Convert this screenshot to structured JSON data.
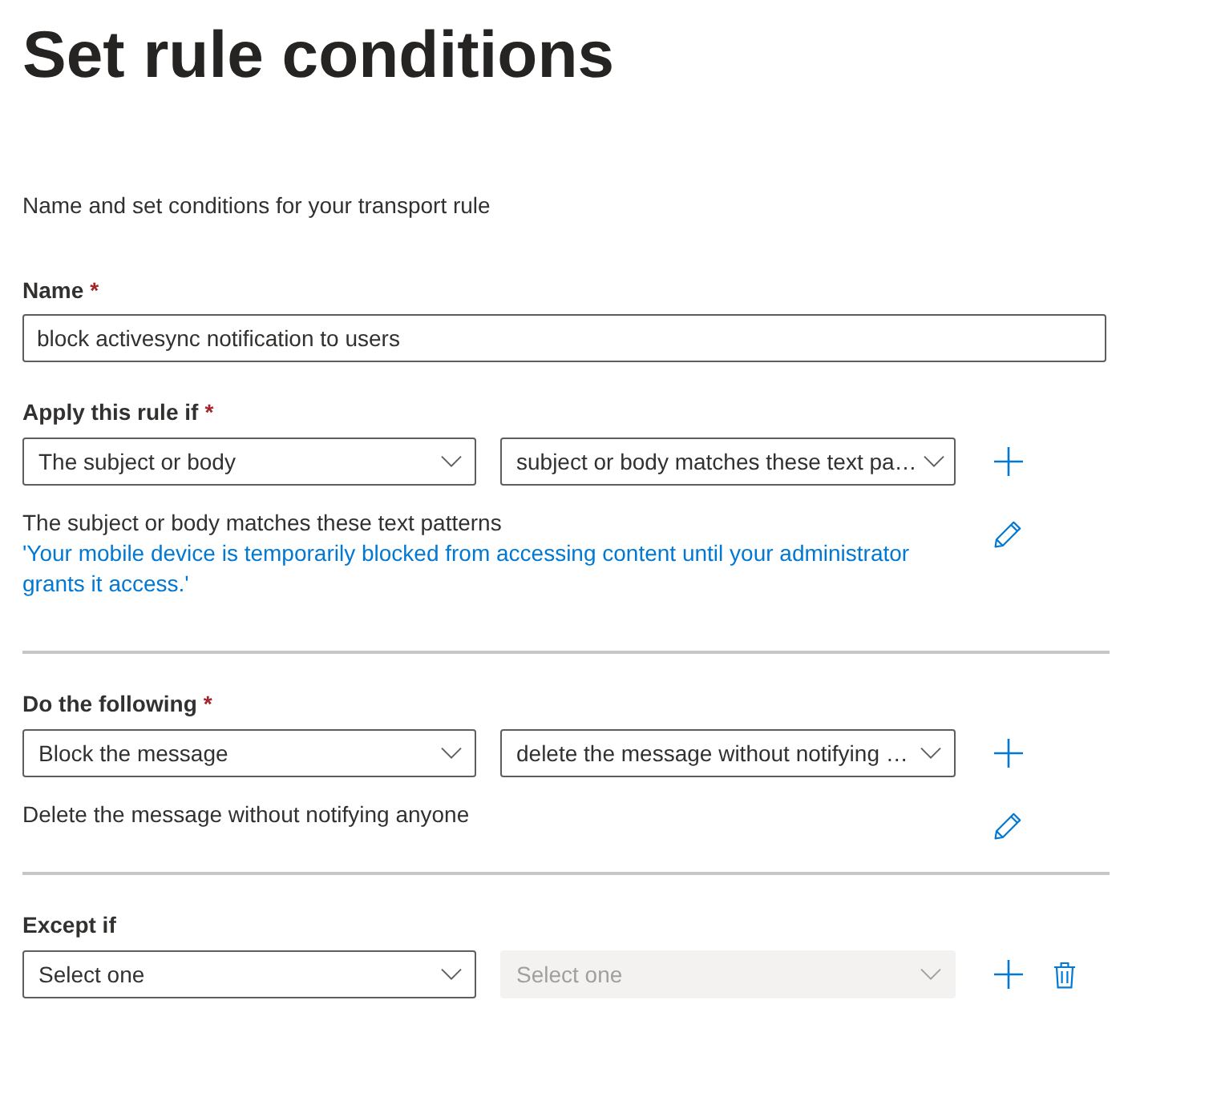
{
  "title": "Set rule conditions",
  "description": "Name and set conditions for your transport rule",
  "name_field": {
    "label": "Name",
    "required_mark": "*",
    "value": "block activesync notification to users"
  },
  "sections": [
    {
      "label": "Apply this rule if",
      "required_mark": "*",
      "dropdowns": [
        {
          "value": "The subject or body",
          "disabled": false
        },
        {
          "value": "subject or body matches these text pa…",
          "disabled": false
        }
      ],
      "summary": "The subject or body matches these text patterns",
      "detail": "'Your mobile device is temporarily blocked from accessing content until your administrator grants it access.'",
      "deletable": false
    },
    {
      "label": "Do the following",
      "required_mark": "*",
      "dropdowns": [
        {
          "value": "Block the message",
          "disabled": false
        },
        {
          "value": "delete the message without notifying …",
          "disabled": false
        }
      ],
      "summary": "Delete the message without notifying anyone",
      "deletable": false
    },
    {
      "label": "Except if",
      "dropdowns": [
        {
          "placeholder": "Select one",
          "disabled": false
        },
        {
          "placeholder": "Select one",
          "disabled": true
        }
      ],
      "deletable": true
    }
  ]
}
